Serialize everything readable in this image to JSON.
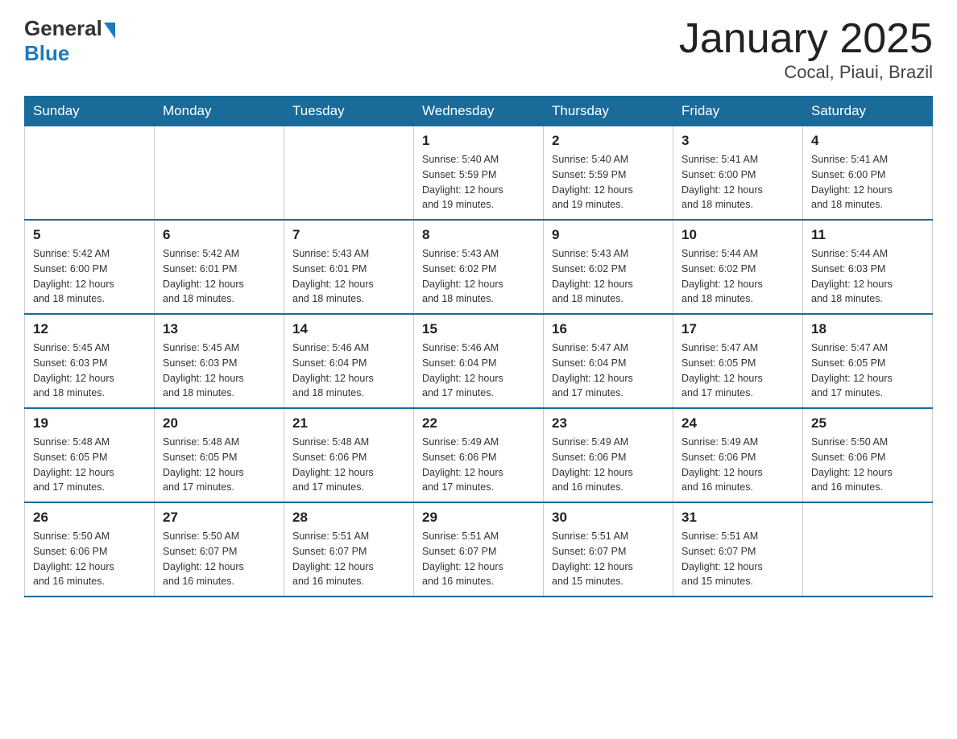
{
  "header": {
    "logo_general": "General",
    "logo_blue": "Blue",
    "title": "January 2025",
    "subtitle": "Cocal, Piaui, Brazil"
  },
  "days_of_week": [
    "Sunday",
    "Monday",
    "Tuesday",
    "Wednesday",
    "Thursday",
    "Friday",
    "Saturday"
  ],
  "weeks": [
    [
      {
        "day": "",
        "info": ""
      },
      {
        "day": "",
        "info": ""
      },
      {
        "day": "",
        "info": ""
      },
      {
        "day": "1",
        "info": "Sunrise: 5:40 AM\nSunset: 5:59 PM\nDaylight: 12 hours\nand 19 minutes."
      },
      {
        "day": "2",
        "info": "Sunrise: 5:40 AM\nSunset: 5:59 PM\nDaylight: 12 hours\nand 19 minutes."
      },
      {
        "day": "3",
        "info": "Sunrise: 5:41 AM\nSunset: 6:00 PM\nDaylight: 12 hours\nand 18 minutes."
      },
      {
        "day": "4",
        "info": "Sunrise: 5:41 AM\nSunset: 6:00 PM\nDaylight: 12 hours\nand 18 minutes."
      }
    ],
    [
      {
        "day": "5",
        "info": "Sunrise: 5:42 AM\nSunset: 6:00 PM\nDaylight: 12 hours\nand 18 minutes."
      },
      {
        "day": "6",
        "info": "Sunrise: 5:42 AM\nSunset: 6:01 PM\nDaylight: 12 hours\nand 18 minutes."
      },
      {
        "day": "7",
        "info": "Sunrise: 5:43 AM\nSunset: 6:01 PM\nDaylight: 12 hours\nand 18 minutes."
      },
      {
        "day": "8",
        "info": "Sunrise: 5:43 AM\nSunset: 6:02 PM\nDaylight: 12 hours\nand 18 minutes."
      },
      {
        "day": "9",
        "info": "Sunrise: 5:43 AM\nSunset: 6:02 PM\nDaylight: 12 hours\nand 18 minutes."
      },
      {
        "day": "10",
        "info": "Sunrise: 5:44 AM\nSunset: 6:02 PM\nDaylight: 12 hours\nand 18 minutes."
      },
      {
        "day": "11",
        "info": "Sunrise: 5:44 AM\nSunset: 6:03 PM\nDaylight: 12 hours\nand 18 minutes."
      }
    ],
    [
      {
        "day": "12",
        "info": "Sunrise: 5:45 AM\nSunset: 6:03 PM\nDaylight: 12 hours\nand 18 minutes."
      },
      {
        "day": "13",
        "info": "Sunrise: 5:45 AM\nSunset: 6:03 PM\nDaylight: 12 hours\nand 18 minutes."
      },
      {
        "day": "14",
        "info": "Sunrise: 5:46 AM\nSunset: 6:04 PM\nDaylight: 12 hours\nand 18 minutes."
      },
      {
        "day": "15",
        "info": "Sunrise: 5:46 AM\nSunset: 6:04 PM\nDaylight: 12 hours\nand 17 minutes."
      },
      {
        "day": "16",
        "info": "Sunrise: 5:47 AM\nSunset: 6:04 PM\nDaylight: 12 hours\nand 17 minutes."
      },
      {
        "day": "17",
        "info": "Sunrise: 5:47 AM\nSunset: 6:05 PM\nDaylight: 12 hours\nand 17 minutes."
      },
      {
        "day": "18",
        "info": "Sunrise: 5:47 AM\nSunset: 6:05 PM\nDaylight: 12 hours\nand 17 minutes."
      }
    ],
    [
      {
        "day": "19",
        "info": "Sunrise: 5:48 AM\nSunset: 6:05 PM\nDaylight: 12 hours\nand 17 minutes."
      },
      {
        "day": "20",
        "info": "Sunrise: 5:48 AM\nSunset: 6:05 PM\nDaylight: 12 hours\nand 17 minutes."
      },
      {
        "day": "21",
        "info": "Sunrise: 5:48 AM\nSunset: 6:06 PM\nDaylight: 12 hours\nand 17 minutes."
      },
      {
        "day": "22",
        "info": "Sunrise: 5:49 AM\nSunset: 6:06 PM\nDaylight: 12 hours\nand 17 minutes."
      },
      {
        "day": "23",
        "info": "Sunrise: 5:49 AM\nSunset: 6:06 PM\nDaylight: 12 hours\nand 16 minutes."
      },
      {
        "day": "24",
        "info": "Sunrise: 5:49 AM\nSunset: 6:06 PM\nDaylight: 12 hours\nand 16 minutes."
      },
      {
        "day": "25",
        "info": "Sunrise: 5:50 AM\nSunset: 6:06 PM\nDaylight: 12 hours\nand 16 minutes."
      }
    ],
    [
      {
        "day": "26",
        "info": "Sunrise: 5:50 AM\nSunset: 6:06 PM\nDaylight: 12 hours\nand 16 minutes."
      },
      {
        "day": "27",
        "info": "Sunrise: 5:50 AM\nSunset: 6:07 PM\nDaylight: 12 hours\nand 16 minutes."
      },
      {
        "day": "28",
        "info": "Sunrise: 5:51 AM\nSunset: 6:07 PM\nDaylight: 12 hours\nand 16 minutes."
      },
      {
        "day": "29",
        "info": "Sunrise: 5:51 AM\nSunset: 6:07 PM\nDaylight: 12 hours\nand 16 minutes."
      },
      {
        "day": "30",
        "info": "Sunrise: 5:51 AM\nSunset: 6:07 PM\nDaylight: 12 hours\nand 15 minutes."
      },
      {
        "day": "31",
        "info": "Sunrise: 5:51 AM\nSunset: 6:07 PM\nDaylight: 12 hours\nand 15 minutes."
      },
      {
        "day": "",
        "info": ""
      }
    ]
  ]
}
